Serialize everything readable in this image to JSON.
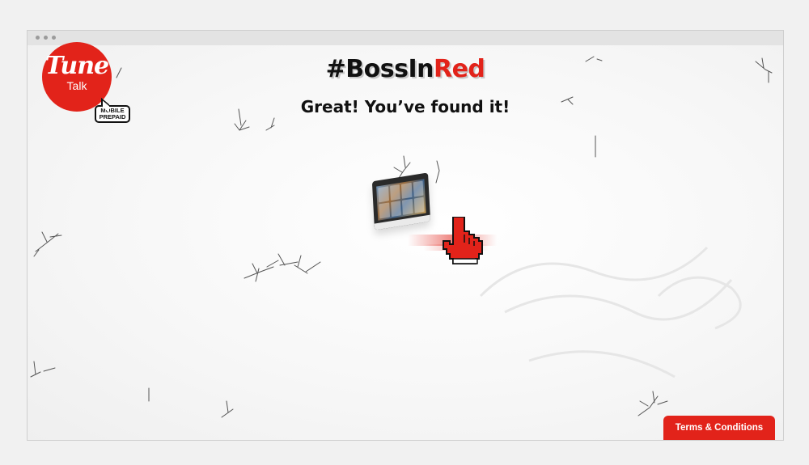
{
  "window": {
    "dots": 3
  },
  "logo": {
    "brand": "Tune",
    "sub": "Talk",
    "badge_line1": "MOBILE",
    "badge_line2": "PREPAID"
  },
  "headline": {
    "hash_part1": "#Boss",
    "hash_part2": "In",
    "hash_part3": "Red"
  },
  "subtitle": "Great! You’ve found it!",
  "footer": {
    "terms_label": "Terms & Conditions"
  },
  "colors": {
    "brand_red": "#e2231a",
    "text_dark": "#111111",
    "snow": "#f7f7f7"
  }
}
